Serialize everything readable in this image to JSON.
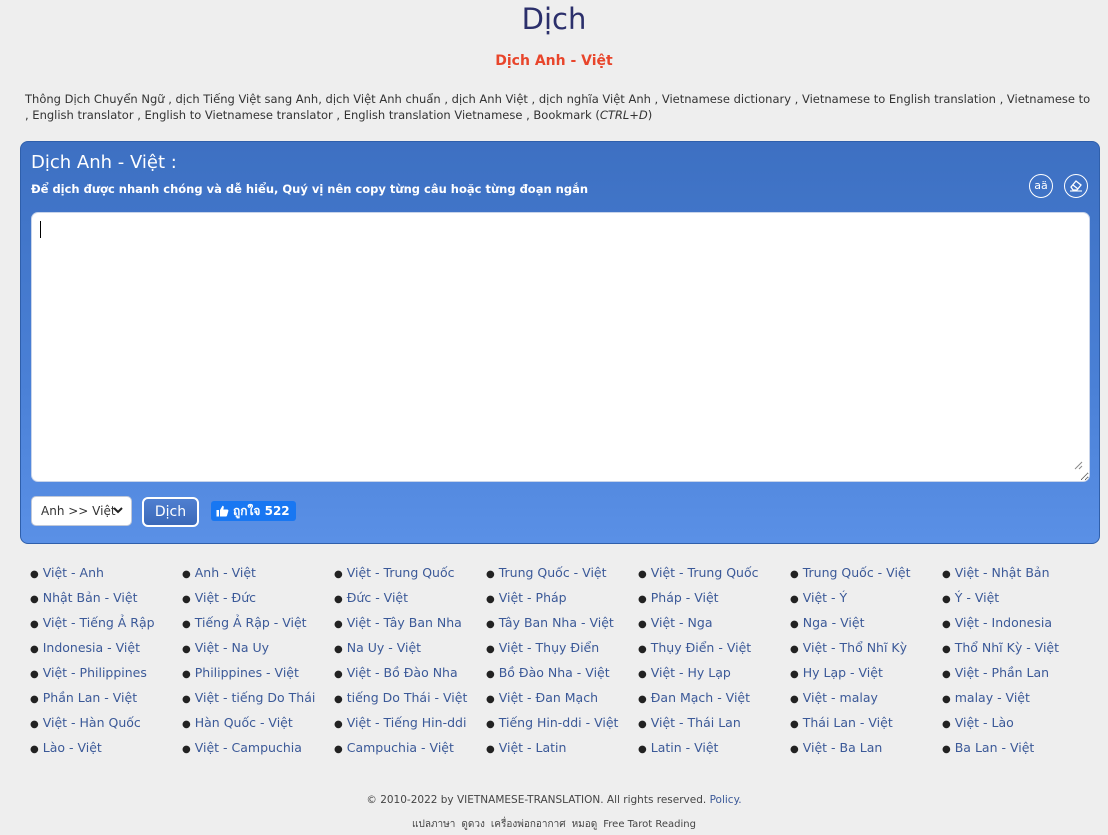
{
  "header": {
    "title": "Dịch",
    "subtitle": "Dịch Anh - Việt",
    "keywords": "Thông Dịch Chuyển Ngữ , dịch Tiếng Việt sang Anh, dịch Việt Anh chuẩn , dịch Anh Việt , dịch nghĩa Việt Anh , Vietnamese dictionary , Vietnamese to English translation , Vietnamese to , English translator , English to Vietnamese translator , English translation Vietnamese , Bookmark (",
    "bookmark_shortcut": "CTRL+D",
    "keywords_end": ")"
  },
  "panel": {
    "title": "Dịch Anh - Việt :",
    "hint": "Để dịch được nhanh chóng và dễ hiểu, Quý vị nên copy từng câu hoặc từng đoạn ngắn",
    "font_button_label": "aä",
    "font_button_icon": "font-size-icon",
    "erase_button_icon": "eraser-icon",
    "source_text": "",
    "language_selected": "Anh >> Việt",
    "translate_label": "Dịch",
    "like_label": "ถูกใจ 522",
    "like_icon": "thumbs-up-icon"
  },
  "language_links": [
    "Việt - Anh",
    "Anh - Việt",
    "Việt - Trung Quốc",
    "Trung Quốc - Việt",
    "Việt - Trung Quốc",
    "Trung Quốc - Việt",
    "Việt - Nhật Bản",
    "Nhật Bản - Việt",
    "Việt - Đức",
    "Đức - Việt",
    "Việt - Pháp",
    "Pháp - Việt",
    "Việt - Ý",
    "Ý - Việt",
    "Việt - Tiếng Ả Rập",
    "Tiếng Ả Rập - Việt",
    "Việt - Tây Ban Nha",
    "Tây Ban Nha - Việt",
    "Việt - Nga",
    "Nga - Việt",
    "Việt - Indonesia",
    "Indonesia - Việt",
    "Việt - Na Uy",
    "Na Uy - Việt",
    "Việt - Thụy Điển",
    "Thụy Điển - Việt",
    "Việt - Thổ Nhĩ Kỳ",
    "Thổ Nhĩ Kỳ - Việt",
    "Việt - Philippines",
    "Philippines - Việt",
    "Việt - Bồ Đào Nha",
    "Bồ Đào Nha - Việt",
    "Việt - Hy Lạp",
    "Hy Lạp - Việt",
    "Việt - Phần Lan",
    "Phần Lan - Việt",
    "Việt - tiếng Do Thái",
    "tiếng Do Thái - Việt",
    "Việt - Đan Mạch",
    "Đan Mạch - Việt",
    "Việt - malay",
    "malay - Việt",
    "Việt - Hàn Quốc",
    "Hàn Quốc - Việt",
    "Việt - Tiếng Hin-ddi",
    "Tiếng Hin-ddi - Việt",
    "Việt - Thái Lan",
    "Thái Lan - Việt",
    "Việt - Lào",
    "Lào - Việt",
    "Việt - Campuchia",
    "Campuchia - Việt",
    "Việt - Latin",
    "Latin - Việt",
    "Việt - Ba Lan",
    "Ba Lan - Việt"
  ],
  "footer": {
    "copyright": "© 2010-2022 by VIETNAMESE-TRANSLATION. All rights reserved.",
    "policy": "Policy.",
    "links": [
      "แปลภาษา",
      "ดูดวง",
      "เครื่องพ่อกอากาศ",
      "หมอดู",
      "Free Tarot Reading"
    ]
  },
  "colors": {
    "panel_blue": "#3d70c2",
    "subtitle_red": "#e8452b",
    "title_navy": "#2b2f6b",
    "link_blue": "#3b5998",
    "facebook_blue": "#1877f2"
  }
}
